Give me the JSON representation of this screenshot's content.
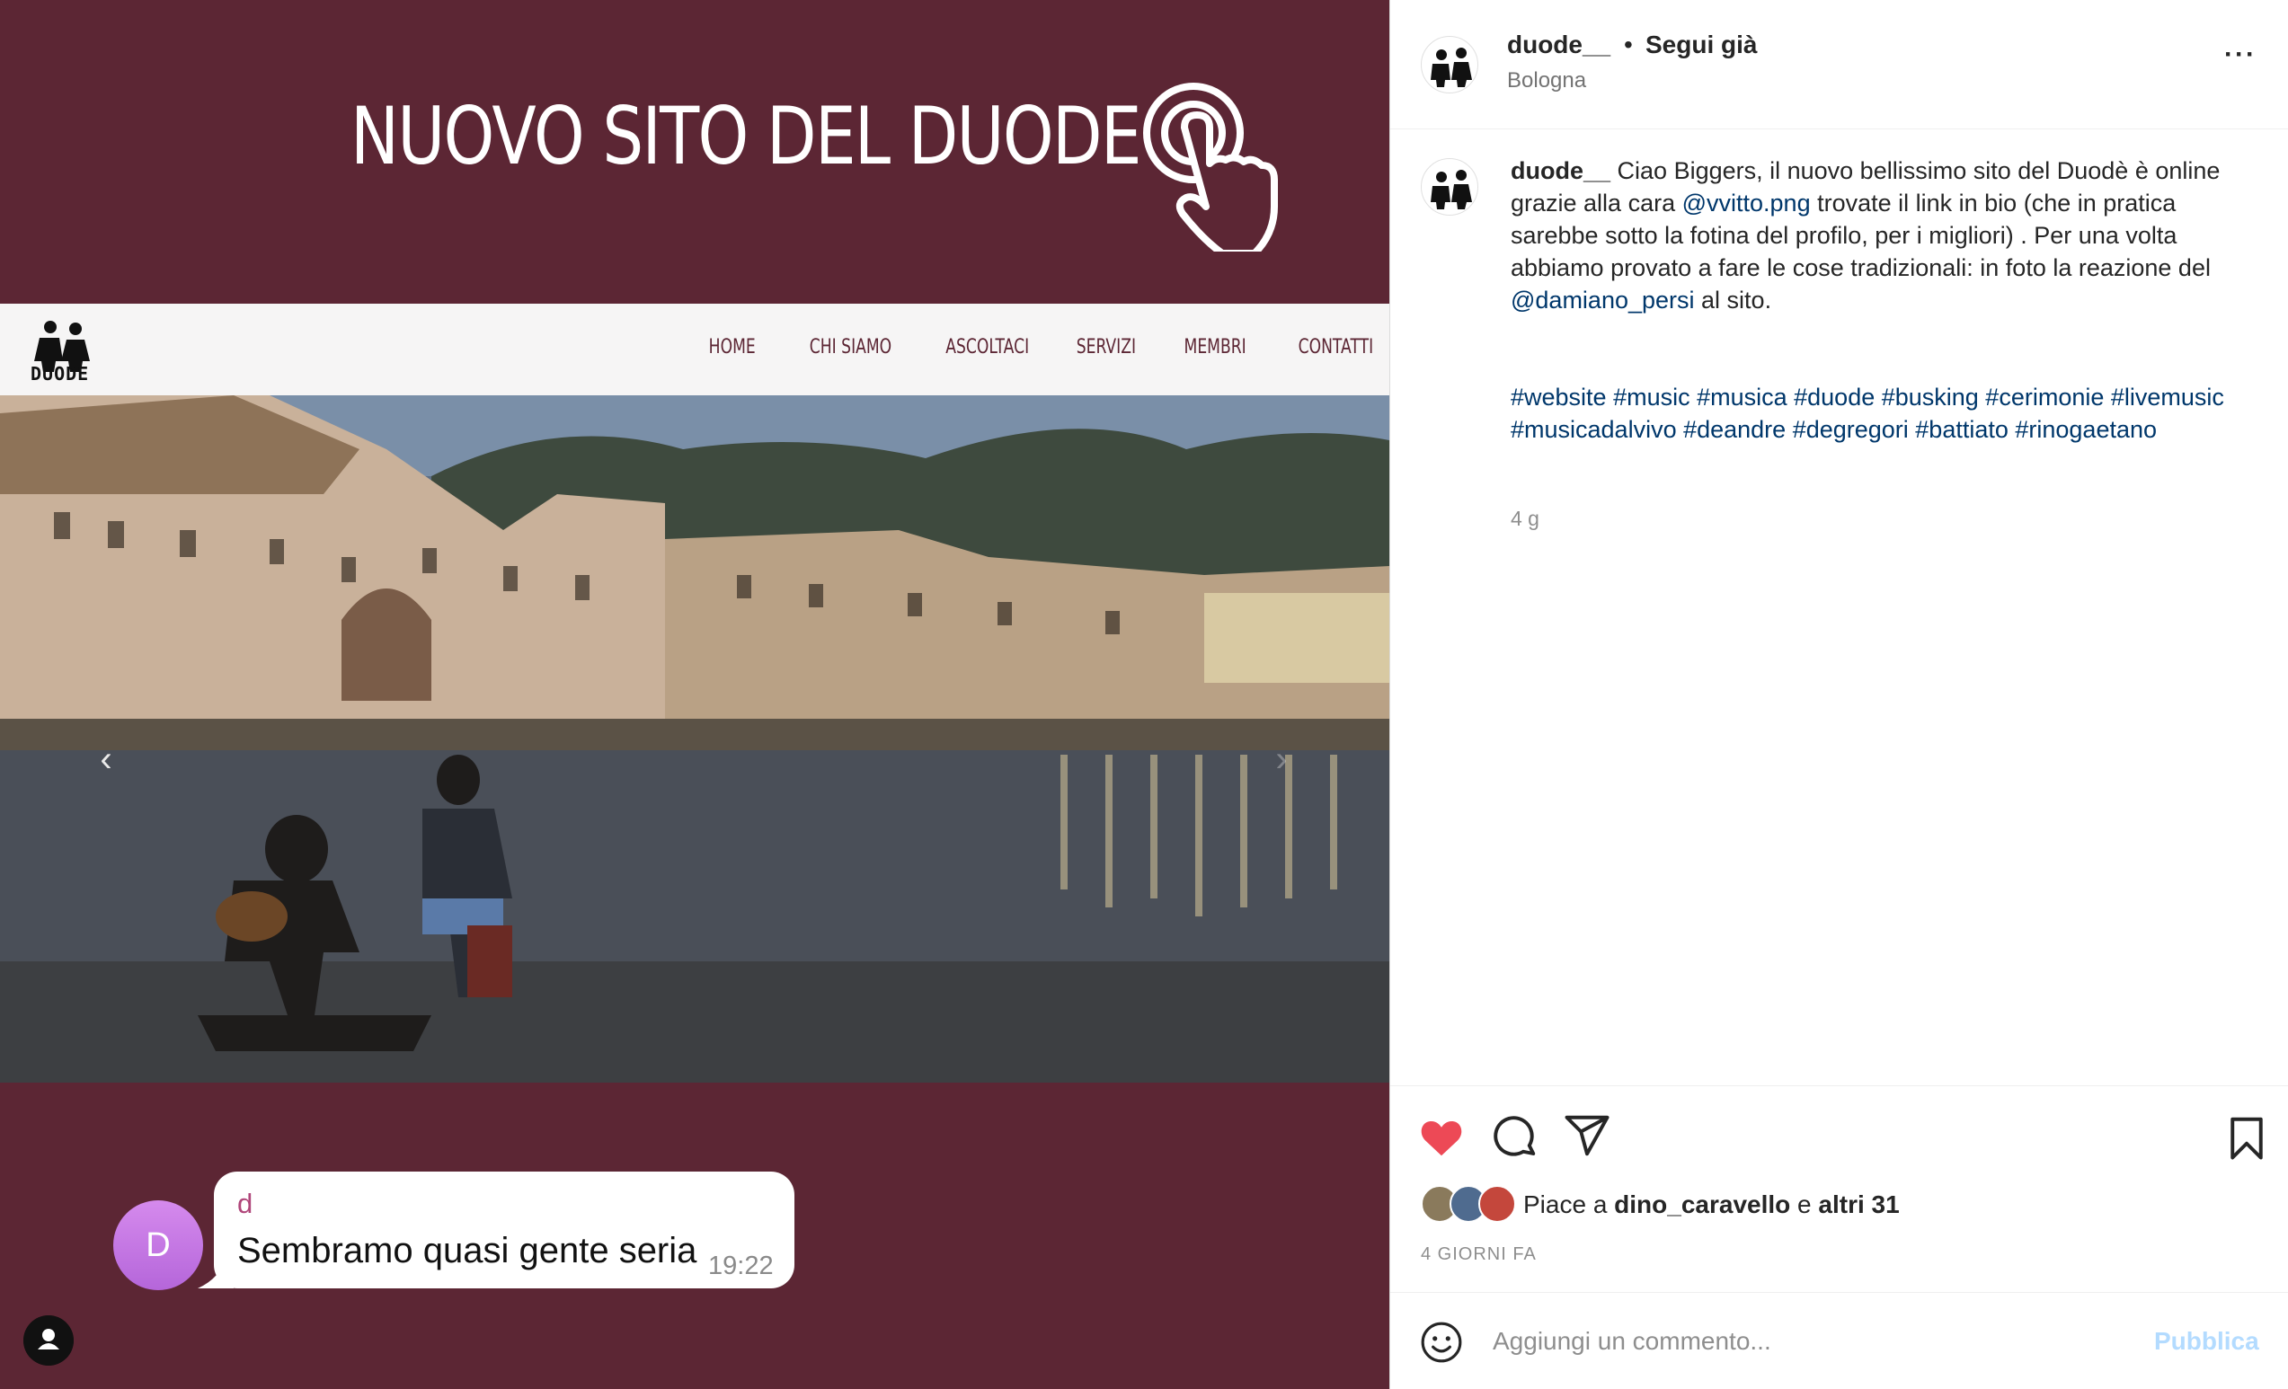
{
  "media": {
    "banner_title": "NUOVO SITO DEL DUODE",
    "site_logo_text": "DUODE",
    "site_menu": [
      "HOME",
      "CHI SIAMO",
      "ASCOLTACI",
      "SERVIZI",
      "MEMBRI",
      "CONTATTI"
    ],
    "chat": {
      "avatar_letter": "D",
      "sender": "d",
      "message": "Sembramo quasi gente seria",
      "time": "19:22"
    },
    "colors": {
      "banner_bg": "#5c2634",
      "nav_bg": "#f6f5f5"
    }
  },
  "post": {
    "username": "duode__",
    "dot": "•",
    "follow_status": "Segui già",
    "location": "Bologna",
    "more_icon": "more-horizontal-icon",
    "caption": {
      "username": "duode__",
      "part1": " Ciao Biggers, il nuovo bellissimo sito del Duodè è online",
      "part2": "grazie alla cara ",
      "mention1": "@vvitto.png",
      "part3": " trovate il link in bio (che in pratica sarebbe sotto la fotina del profilo, per i migliori) . Per una volta abbiamo provato a fare le cose tradizionali: in foto la reazione del ",
      "mention2": "@damiano_persi",
      "part4": " al sito."
    },
    "hashtags": "#website #music #musica #duode #busking #cerimonie #livemusic #musicadalvivo #deandre #degregori #battiato #rinogaetano",
    "age": "4 g",
    "likes": {
      "prefix": "Piace a ",
      "user": "dino_caravello",
      "middle": " e ",
      "others": "altri 31"
    },
    "date": "4 GIORNI FA",
    "comment_placeholder": "Aggiungi un commento...",
    "publish_label": "Pubblica",
    "colors": {
      "like": "#ed4956",
      "link": "#00376b",
      "publish": "#b3dbff"
    }
  }
}
